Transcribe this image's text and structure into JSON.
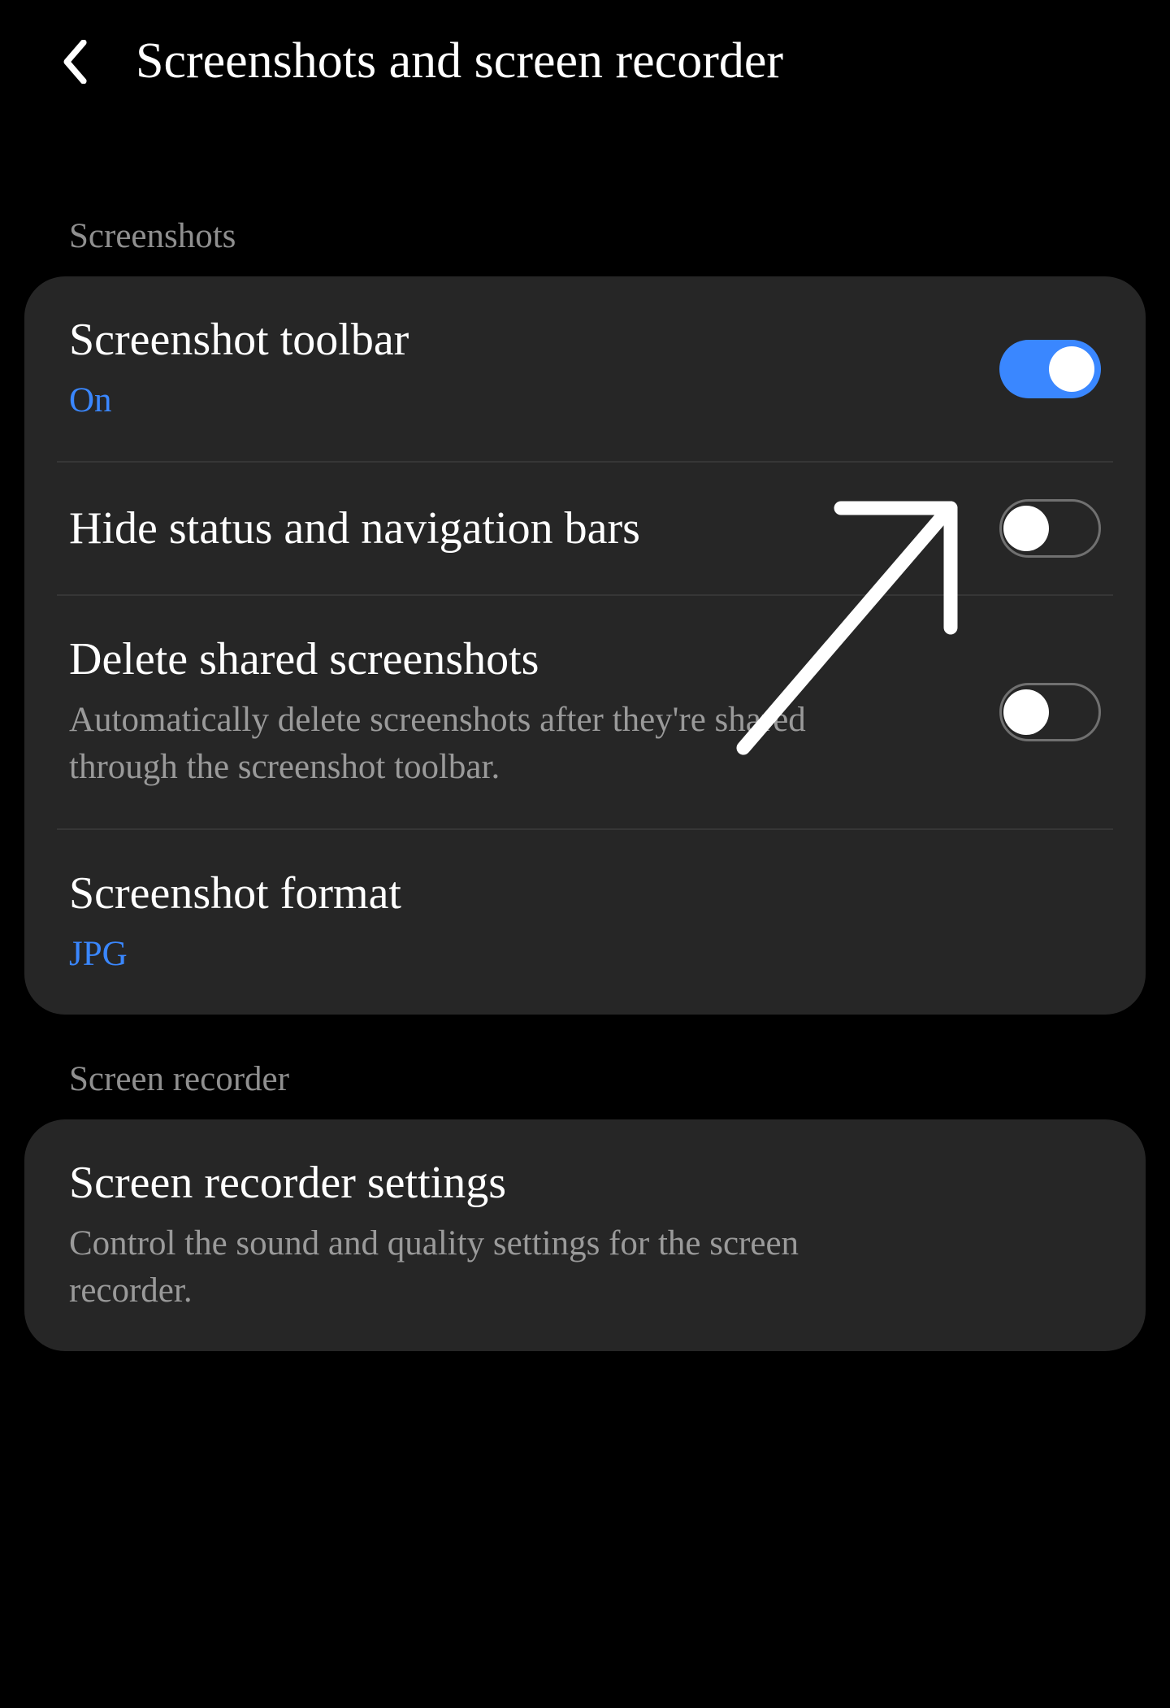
{
  "header": {
    "title": "Screenshots and screen recorder"
  },
  "sections": {
    "screenshots": {
      "heading": "Screenshots",
      "items": {
        "toolbar": {
          "title": "Screenshot toolbar",
          "sub": "On",
          "toggle": "on"
        },
        "hide_bars": {
          "title": "Hide status and navigation bars",
          "toggle": "off"
        },
        "delete_shared": {
          "title": "Delete shared screenshots",
          "sub": "Automatically delete screenshots after they're shared through the screenshot toolbar.",
          "toggle": "off"
        },
        "format": {
          "title": "Screenshot format",
          "sub": "JPG"
        }
      }
    },
    "recorder": {
      "heading": "Screen recorder",
      "items": {
        "settings": {
          "title": "Screen recorder settings",
          "sub": "Control the sound and quality settings for the screen recorder."
        }
      }
    }
  }
}
